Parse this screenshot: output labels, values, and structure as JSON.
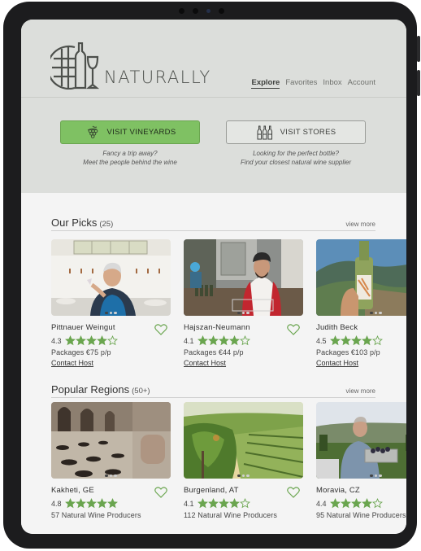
{
  "brand": {
    "name": "NATURALLY",
    "logo_icon": "wine-bottle-glass-logo"
  },
  "nav": [
    {
      "label": "Explore",
      "active": true
    },
    {
      "label": "Favorites",
      "active": false
    },
    {
      "label": "Inbox",
      "active": false
    },
    {
      "label": "Account",
      "active": false
    }
  ],
  "hero": {
    "vineyards": {
      "label": "VISIT VINEYARDS",
      "icon": "grapes-icon",
      "line1": "Fancy a trip away?",
      "line2": "Meet the people behind the wine"
    },
    "stores": {
      "label": "VISIT STORES",
      "icon": "bottles-icon",
      "line1": "Looking for the perfect bottle?",
      "line2": "Find your closest natural wine supplier"
    }
  },
  "picks": {
    "title": "Our Picks",
    "count": "(25)",
    "view_more": "view more",
    "items": [
      {
        "name": "Pittnauer Weingut",
        "rating": "4.3",
        "stars": 4,
        "price": "Packages €75 p/p",
        "contact": "Contact Host"
      },
      {
        "name": "Hajszan-Neumann",
        "rating": "4.1",
        "stars": 4,
        "price": "Packages €44 p/p",
        "contact": "Contact Host"
      },
      {
        "name": "Judith Beck",
        "rating": "4.5",
        "stars": 4,
        "price": "Packages €103 p/p",
        "contact": "Contact Host"
      }
    ]
  },
  "regions": {
    "title": "Popular Regions",
    "count": "(50+)",
    "view_more": "view more",
    "items": [
      {
        "name": "Kakheti, GE",
        "rating": "4.8",
        "stars": 5,
        "producers": "57 Natural Wine Producers"
      },
      {
        "name": "Burgenland, AT",
        "rating": "4.1",
        "stars": 4,
        "producers": "112 Natural Wine Producers"
      },
      {
        "name": "Moravia, CZ",
        "rating": "4.4",
        "stars": 4,
        "producers": "95 Natural Wine Producers"
      }
    ]
  },
  "colors": {
    "accent": "#7fc163",
    "star": "#6aa54f",
    "header_bg": "#dcdedb"
  }
}
